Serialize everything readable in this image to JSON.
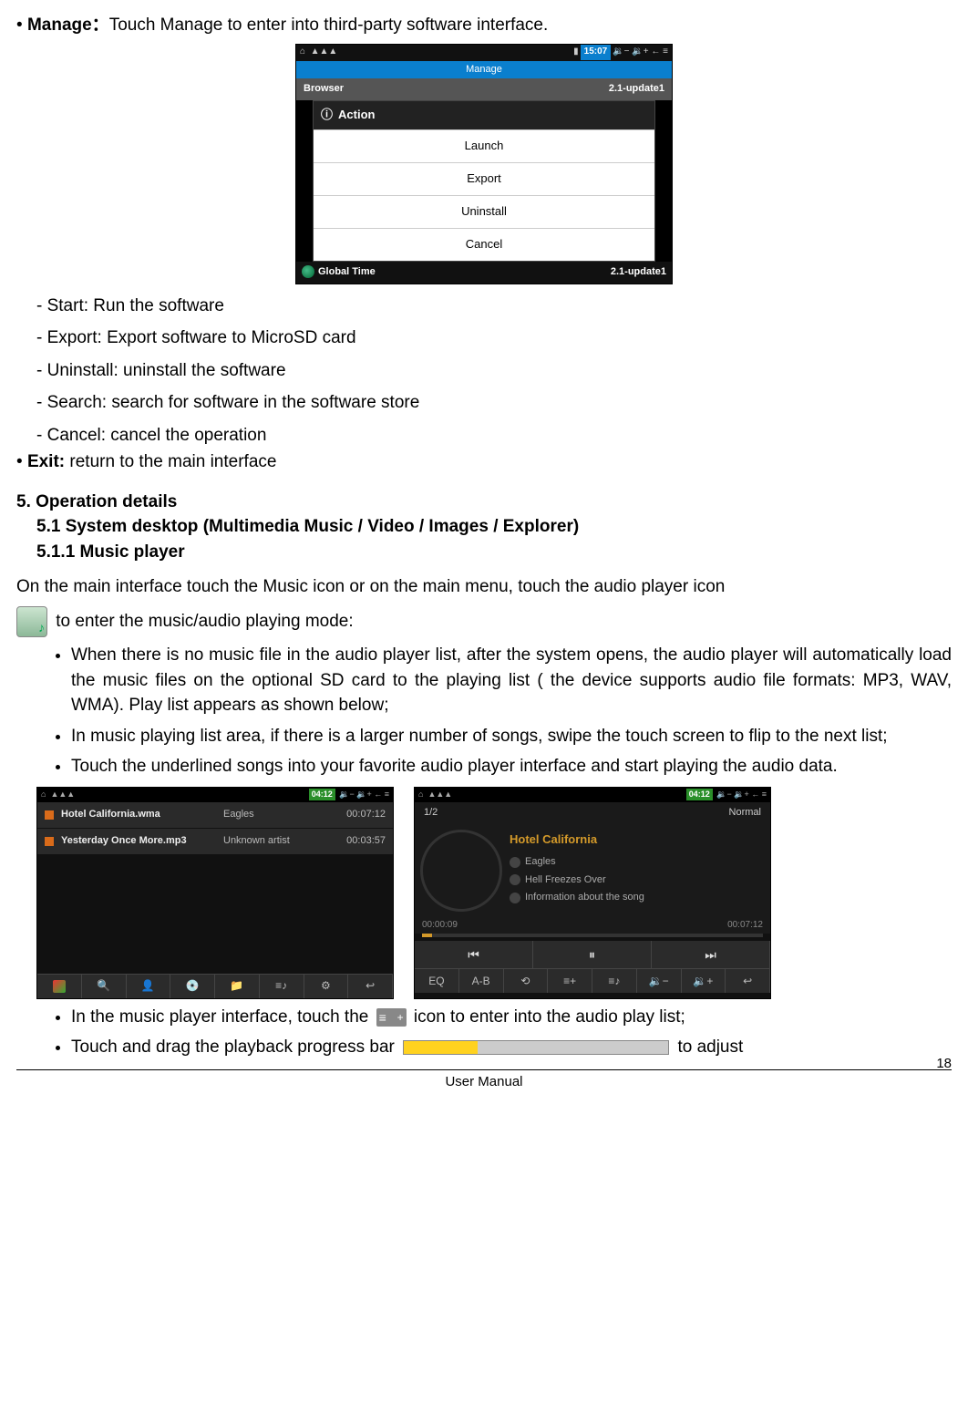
{
  "p1_prefix": "• ",
  "p1_bold": "Manage：",
  "p1_rest": "Touch Manage to enter into third-party software interface.",
  "shot1": {
    "clock": "15:07",
    "managehdr": "Manage",
    "browser": "Browser",
    "browser_ver": "2.1-update1",
    "dialog_title": "Action",
    "items": [
      "Launch",
      "Export",
      "Uninstall",
      "Cancel"
    ],
    "globaltime": "Global Time",
    "globaltime_ver": "2.1-update1"
  },
  "defs": [
    "- Start: Run the software",
    "- Export: Export software to MicroSD card",
    "- Uninstall: uninstall the software",
    "- Search: search for software in the software store",
    "- Cancel: cancel the operation"
  ],
  "exit_prefix": "• ",
  "exit_bold": "Exit: ",
  "exit_rest": "return to the main interface",
  "h5": "5. Operation details",
  "h51": "5.1 System desktop (Multimedia Music / Video / Images / Explorer)",
  "h511": "5.1.1 Music player",
  "intro": "On the main interface touch the Music icon or on the main menu, touch the audio player icon",
  "intro2": " to enter the music/audio playing mode:",
  "bullets1": [
    "When there is no music file in the audio player list, after the system opens, the audio player will automatically load the music files on the optional SD card to the playing list ( the device supports audio file formats: MP3, WAV, WMA). Play list appears as shown below;",
    "In music playing list area, if there is a larger number of songs, swipe the touch screen to flip to the next list;",
    "Touch the underlined songs into your favorite audio player interface and start playing the audio data."
  ],
  "shot2": {
    "clock": "04:12",
    "rows": [
      {
        "title": "Hotel California.wma",
        "artist": "Eagles",
        "dur": "00:07:12"
      },
      {
        "title": "Yesterday Once More.mp3",
        "artist": "Unknown artist",
        "dur": "00:03:57"
      }
    ]
  },
  "shot3": {
    "clock": "04:12",
    "counter": "1/2",
    "mode": "Normal",
    "song": "Hotel California",
    "artist": "Eagles",
    "album": "Hell Freezes Over",
    "info": "Information about the song",
    "elapsed": "00:00:09",
    "total": "00:07:12",
    "eq": "EQ",
    "ab": "A-B"
  },
  "b4a": "In the music player interface, touch the ",
  "b4b": " icon to enter into the audio play list;",
  "b5a": "Touch and drag the playback progress bar ",
  "b5b": " to adjust",
  "footer_center": "User Manual",
  "footer_page": "18"
}
